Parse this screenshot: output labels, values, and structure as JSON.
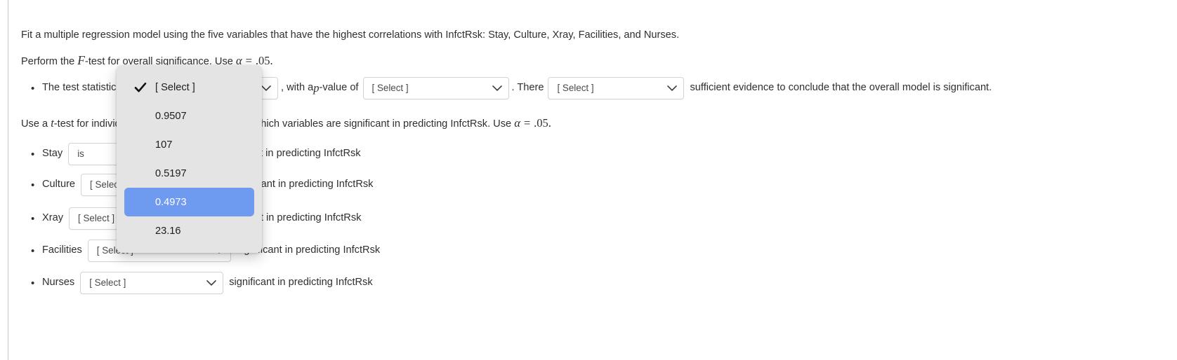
{
  "problem": {
    "line1": "Fit a multiple regression model using the five variables that have the highest correlations with InfctRsk:  Stay, Culture, Xray, Facilities, and Nurses.",
    "line2_pre": "Perform the ",
    "line2_f": "F",
    "line2_mid": "-test for overall significance.  Use ",
    "line2_alpha": "α",
    "line2_eq": "=",
    "line2_val": ".05.",
    "line3_pre": "Use a ",
    "line3_t": "t",
    "line3_mid": "-test for individual significance to determine which variables are significant in predicting InfctRsk.  Use ",
    "line3_alpha": "α",
    "line3_eq": "=",
    "line3_val": ".05."
  },
  "ftest_row": {
    "label": "The test statistic is",
    "teststat_value": "",
    "mid_text_a": ", with a ",
    "mid_text_p": "p",
    "mid_text_b": "-value of ",
    "pvalue_value": "[ Select ]",
    "after_pvalue": ".  There ",
    "there_value": "[ Select ]",
    "tail": "sufficient evidence to conclude that the overall model is significant."
  },
  "variables": [
    {
      "name": "Stay",
      "select_value": "is",
      "tail": "significant in predicting InfctRsk"
    },
    {
      "name": "Culture",
      "select_value": "[ Select ]",
      "tail": "significant in predicting InfctRsk"
    },
    {
      "name": "Xray",
      "select_value": "[ Select ]",
      "tail": "significant in predicting InfctRsk"
    },
    {
      "name": "Facilities",
      "select_value": "[ Select ]",
      "tail": "significant in predicting InfctRsk"
    },
    {
      "name": "Nurses",
      "select_value": "[ Select ]",
      "tail": "significant in predicting InfctRsk"
    }
  ],
  "dropdown": {
    "options": [
      {
        "label": "[ Select ]",
        "checked": true,
        "highlighted": false
      },
      {
        "label": "0.9507",
        "checked": false,
        "highlighted": false
      },
      {
        "label": "107",
        "checked": false,
        "highlighted": false
      },
      {
        "label": "0.5197",
        "checked": false,
        "highlighted": false
      },
      {
        "label": "0.4973",
        "checked": false,
        "highlighted": true
      },
      {
        "label": "23.16",
        "checked": false,
        "highlighted": false
      }
    ]
  },
  "colors": {
    "highlight": "#6e9af0",
    "menu_bg": "#e4e4e4",
    "text": "#2f2f2f",
    "select_border": "#d4d4d4"
  },
  "icons": {
    "caret": "chevron-down-icon",
    "check": "checkmark-icon",
    "bullet": "bullet-dot-icon"
  }
}
